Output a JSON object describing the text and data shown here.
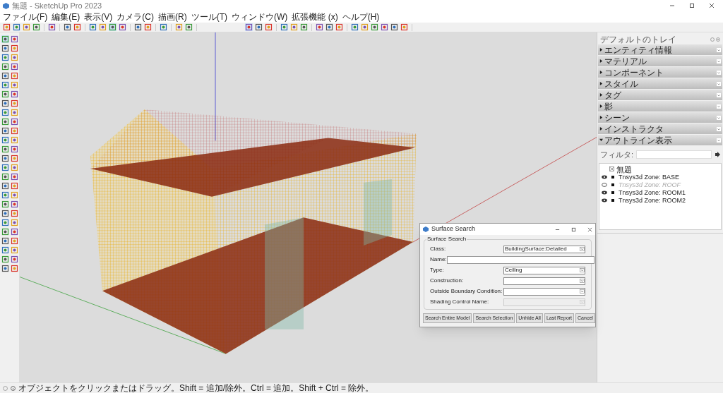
{
  "window": {
    "title": "無題 - SketchUp Pro 2023"
  },
  "menu": [
    "ファイル(F)",
    "編集(E)",
    "表示(V)",
    "カメラ(C)",
    "描画(R)",
    "ツール(T)",
    "ウィンドウ(W)",
    "拡張機能 (x)",
    "ヘルプ(H)"
  ],
  "tray": {
    "title": "デフォルトのトレイ",
    "sections": [
      {
        "label": "エンティティ情報",
        "expanded": false
      },
      {
        "label": "マテリアル",
        "expanded": false
      },
      {
        "label": "コンポーネント",
        "expanded": false
      },
      {
        "label": "スタイル",
        "expanded": false
      },
      {
        "label": "タグ",
        "expanded": false
      },
      {
        "label": "影",
        "expanded": false
      },
      {
        "label": "シーン",
        "expanded": false
      },
      {
        "label": "インストラクタ",
        "expanded": false
      },
      {
        "label": "アウトライン表示",
        "expanded": true
      }
    ],
    "filter_label": "フィルタ:",
    "outline": {
      "label": "無題",
      "checked": true,
      "children": [
        {
          "label": "Tnsys3d Zone: BASE",
          "visible": true
        },
        {
          "label": "Tnsys3d Zone: ROOF",
          "visible": false
        },
        {
          "label": "Tnsys3d Zone: ROOM1",
          "visible": true
        },
        {
          "label": "Tnsys3d Zone: ROOM2",
          "visible": true
        }
      ]
    }
  },
  "dialog": {
    "title": "Surface Search",
    "group": "Surface Search",
    "fields": [
      {
        "label": "Class:",
        "kind": "select",
        "value": "BuildingSurface:Detailed",
        "disabled": false
      },
      {
        "label": "Name:",
        "kind": "text",
        "disabled": false
      },
      {
        "label": "Type:",
        "kind": "select",
        "value": "Ceiling",
        "disabled": false
      },
      {
        "label": "Construction:",
        "kind": "select",
        "disabled": false
      },
      {
        "label": "Outside Boundary Condition:",
        "kind": "select",
        "disabled": false
      },
      {
        "label": "Shading Control Name:",
        "kind": "select",
        "disabled": true
      }
    ],
    "buttons": [
      "Search Entire Model",
      "Search Selection",
      "Unhide All",
      "Last Report",
      "Cancel"
    ]
  },
  "status_bar": {
    "text": "オブジェクトをクリックまたはドラッグ。Shift = 追加/除外。Ctrl = 追加。Shift + Ctrl = 除外。"
  }
}
